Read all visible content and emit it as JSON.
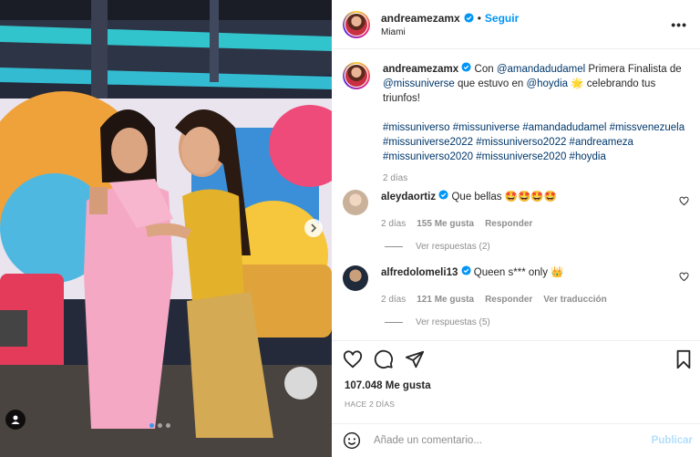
{
  "header": {
    "username": "andreamezamx",
    "separator": "•",
    "follow_label": "Seguir",
    "location": "Miami",
    "more_label": "•••"
  },
  "caption": {
    "username": "andreamezamx",
    "text_1": "Con",
    "mention_1": "@amandadudamel",
    "text_2": "Primera Finalista de",
    "mention_2": "@missuniverse",
    "text_3": "que estuvo en",
    "mention_3": "@hoydia",
    "emoji": "🌟",
    "text_4": "celebrando tus triunfos!",
    "hashtags": "#missuniverso #missuniverse #amandadudamel #missvenezuela #missuniverse2022 #missuniverso2022 #andreameza #missuniverso2020 #missuniverse2020 #hoydia",
    "time": "2 días"
  },
  "comments": [
    {
      "username": "aleydaortiz",
      "text": "Que bellas 🤩🤩🤩🤩",
      "time": "2 días",
      "likes": "155 Me gusta",
      "reply": "Responder",
      "translate": "",
      "view_replies": "Ver respuestas (2)"
    },
    {
      "username": "alfredolomeli13",
      "text": "Queen s*** only 👑",
      "time": "2 días",
      "likes": "121 Me gusta",
      "reply": "Responder",
      "translate": "Ver traducción",
      "view_replies": "Ver respuestas (5)"
    }
  ],
  "actions": {
    "likes": "107.048 Me gusta",
    "posted": "HACE 2 DÍAS"
  },
  "add_comment": {
    "placeholder": "Añade un comentario...",
    "publish_label": "Publicar"
  },
  "icons": {
    "like": "heart-icon",
    "comment": "comment-icon",
    "share": "share-icon",
    "save": "bookmark-icon",
    "emoji": "emoji-icon",
    "verified": "verified-badge-icon",
    "next": "chevron-right-icon",
    "tags": "user-tag-icon"
  },
  "colors": {
    "accent": "#0095f6",
    "link": "#00376b",
    "muted": "#8e8e8e",
    "publish_disabled": "#b2dffc"
  },
  "media": {
    "slide_count": 3,
    "current_slide": 1
  }
}
